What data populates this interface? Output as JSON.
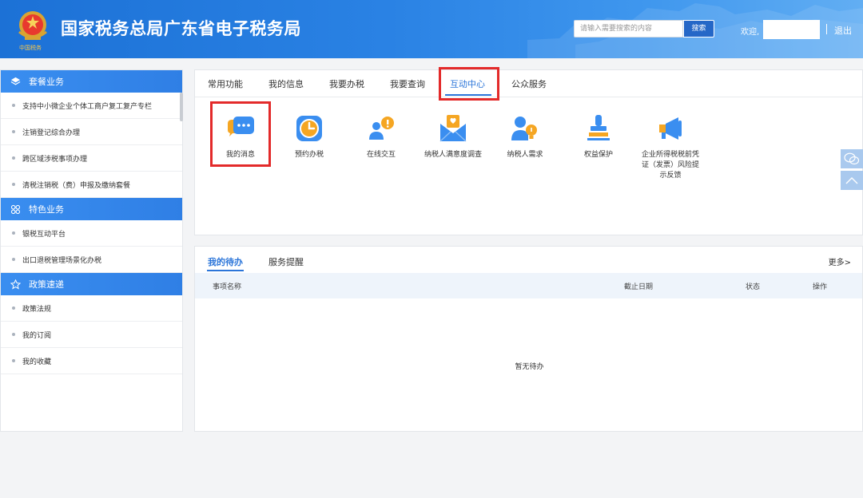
{
  "header": {
    "emblem_text": "中国税务",
    "title": "国家税务总局广东省电子税务局",
    "search_placeholder": "请输入需要搜索的内容",
    "search_button": "搜索",
    "welcome": "欢迎,",
    "logout": "退出"
  },
  "sidebar": {
    "sections": [
      {
        "title": "套餐业务",
        "icon": "layers-icon",
        "items": [
          "支持中小微企业个体工商户复工复产专栏",
          "注销登记综合办理",
          "跨区域涉税事项办理",
          "清税注销税（费）申报及缴纳套餐"
        ]
      },
      {
        "title": "特色业务",
        "icon": "grid-icon",
        "items": [
          "银税互动平台",
          "出口退税管理场景化办税"
        ]
      },
      {
        "title": "政策速递",
        "icon": "star-icon",
        "items": [
          "政策法规",
          "我的订阅",
          "我的收藏"
        ]
      }
    ]
  },
  "tabs": [
    "常用功能",
    "我的信息",
    "我要办税",
    "我要查询",
    "互动中心",
    "公众服务"
  ],
  "active_tab": "互动中心",
  "functions": [
    {
      "label": "我的消息",
      "icon": "message-bubble-icon"
    },
    {
      "label": "预约办税",
      "icon": "clock-icon"
    },
    {
      "label": "在线交互",
      "icon": "people-chat-icon"
    },
    {
      "label": "纳税人满意度调查",
      "icon": "envelope-heart-icon"
    },
    {
      "label": "纳税人需求",
      "icon": "user-idea-icon"
    },
    {
      "label": "权益保护",
      "icon": "stamp-icon"
    },
    {
      "label": "企业所得税税前凭证（发票）风险提示反馈",
      "icon": "megaphone-icon"
    }
  ],
  "todo": {
    "tabs": [
      "我的待办",
      "服务提醒"
    ],
    "more": "更多>",
    "columns": [
      "事项名称",
      "截止日期",
      "状态",
      "操作"
    ],
    "empty_text": "暂无待办"
  },
  "colors": {
    "primary": "#2b75d9",
    "highlight": "#e32a2a",
    "header": "#2a82e4"
  }
}
